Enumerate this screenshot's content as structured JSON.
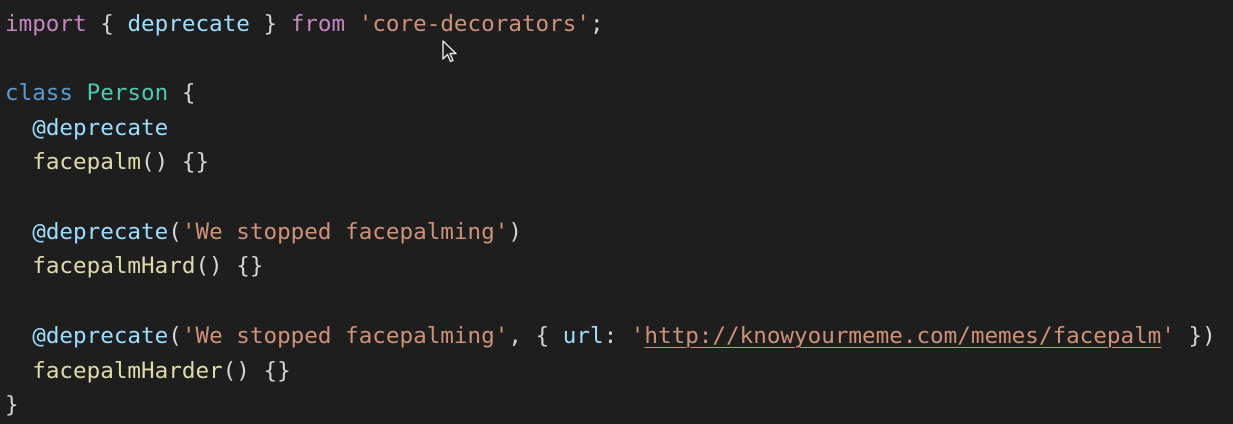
{
  "editor": {
    "lines": [
      {
        "tokens": [
          {
            "t": "import",
            "c": "keyword"
          },
          {
            "t": " { ",
            "c": "punct"
          },
          {
            "t": "deprecate",
            "c": "var"
          },
          {
            "t": " } ",
            "c": "punct"
          },
          {
            "t": "from",
            "c": "keyword"
          },
          {
            "t": " ",
            "c": "punct"
          },
          {
            "t": "'core-decorators'",
            "c": "string"
          },
          {
            "t": ";",
            "c": "punct"
          }
        ]
      },
      {
        "tokens": []
      },
      {
        "tokens": [
          {
            "t": "class",
            "c": "storage"
          },
          {
            "t": " ",
            "c": "punct"
          },
          {
            "t": "Person",
            "c": "class"
          },
          {
            "t": " {",
            "c": "punct"
          }
        ]
      },
      {
        "tokens": [
          {
            "t": "  ",
            "c": "punct"
          },
          {
            "t": "@deprecate",
            "c": "var"
          }
        ]
      },
      {
        "tokens": [
          {
            "t": "  ",
            "c": "punct"
          },
          {
            "t": "facepalm",
            "c": "func"
          },
          {
            "t": "() {}",
            "c": "punct"
          }
        ]
      },
      {
        "tokens": []
      },
      {
        "tokens": [
          {
            "t": "  ",
            "c": "punct"
          },
          {
            "t": "@deprecate",
            "c": "var"
          },
          {
            "t": "(",
            "c": "punct"
          },
          {
            "t": "'We stopped facepalming'",
            "c": "string"
          },
          {
            "t": ")",
            "c": "punct"
          }
        ]
      },
      {
        "tokens": [
          {
            "t": "  ",
            "c": "punct"
          },
          {
            "t": "facepalmHard",
            "c": "func"
          },
          {
            "t": "() {}",
            "c": "punct"
          }
        ]
      },
      {
        "tokens": []
      },
      {
        "tokens": [
          {
            "t": "  ",
            "c": "punct"
          },
          {
            "t": "@deprecate",
            "c": "var"
          },
          {
            "t": "(",
            "c": "punct"
          },
          {
            "t": "'We stopped facepalming'",
            "c": "string"
          },
          {
            "t": ", { ",
            "c": "punct"
          },
          {
            "t": "url",
            "c": "var"
          },
          {
            "t": ": ",
            "c": "punct"
          },
          {
            "t": "'",
            "c": "string"
          },
          {
            "t": "http://knowyourmeme.com/memes/facepalm",
            "c": "link"
          },
          {
            "t": "'",
            "c": "string"
          },
          {
            "t": " })",
            "c": "punct"
          }
        ]
      },
      {
        "tokens": [
          {
            "t": "  ",
            "c": "punct"
          },
          {
            "t": "facepalmHarder",
            "c": "func"
          },
          {
            "t": "() {}",
            "c": "punct"
          }
        ]
      },
      {
        "tokens": [
          {
            "t": "}",
            "c": "punct"
          }
        ]
      }
    ]
  },
  "cursor_icon": "mouse-pointer-icon",
  "colors": {
    "background": "#1e1e1e",
    "keyword": "#c586c0",
    "storage": "#569cd6",
    "variable": "#9cdcfe",
    "string": "#ce9178",
    "class": "#4ec9b0",
    "function": "#dcdcaa",
    "punctuation": "#d4d4d4"
  }
}
